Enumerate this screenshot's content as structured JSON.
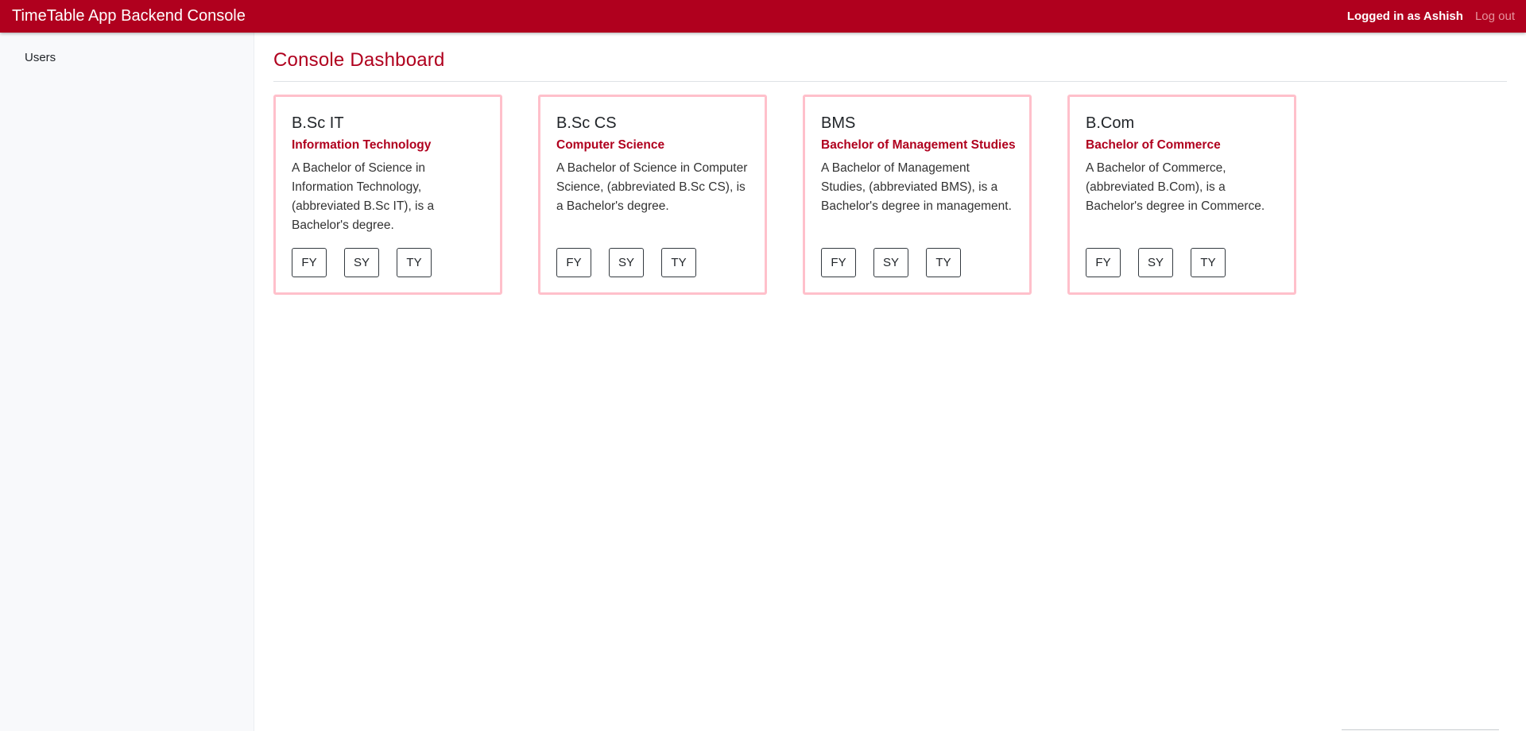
{
  "navbar": {
    "brand": "TimeTable App Backend Console",
    "logged_in_text": "Logged in as Ashish",
    "logout_label": "Log out"
  },
  "sidebar": {
    "items": [
      {
        "label": "Users"
      }
    ]
  },
  "main": {
    "title": "Console Dashboard",
    "cards": [
      {
        "title": "B.Sc IT",
        "subtitle": "Information Technology",
        "description": "A Bachelor of Science in Information Technology, (abbreviated B.Sc IT), is a Bachelor's degree.",
        "buttons": [
          "FY",
          "SY",
          "TY"
        ]
      },
      {
        "title": "B.Sc CS",
        "subtitle": "Computer Science",
        "description": "A Bachelor of Science in Computer Science, (abbreviated B.Sc CS), is a Bachelor's degree.",
        "buttons": [
          "FY",
          "SY",
          "TY"
        ]
      },
      {
        "title": "BMS",
        "subtitle": "Bachelor of Management Studies",
        "description": "A Bachelor of Management Studies, (abbreviated BMS), is a Bachelor's degree in management.",
        "buttons": [
          "FY",
          "SY",
          "TY"
        ]
      },
      {
        "title": "B.Com",
        "subtitle": "Bachelor of Commerce",
        "description": "A Bachelor of Commerce, (abbreviated B.Com), is a Bachelor's degree in Commerce.",
        "buttons": [
          "FY",
          "SY",
          "TY"
        ]
      }
    ]
  },
  "colors": {
    "brand": "#b0001e",
    "card_border": "#ffc0cb",
    "logout": "#e5939e",
    "sidebar_bg": "#f8f9fb"
  }
}
